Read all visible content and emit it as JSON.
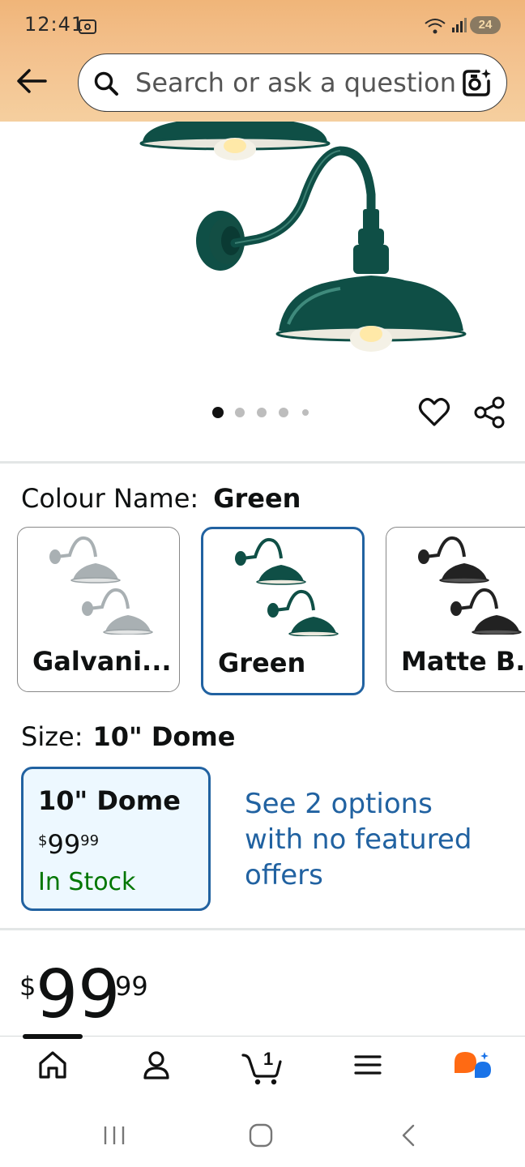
{
  "status_bar": {
    "time": "12:41",
    "battery": "24"
  },
  "search": {
    "placeholder": "Search or ask a question"
  },
  "gallery": {
    "dot_count": 5,
    "active_index": 0
  },
  "colour": {
    "label": "Colour Name:",
    "selected": "Green",
    "options": [
      {
        "name": "Galvani...",
        "swatch": "#a9b0b3"
      },
      {
        "name": "Green",
        "swatch": "#0f4f46"
      },
      {
        "name": "Matte B..",
        "swatch": "#222222"
      }
    ]
  },
  "size": {
    "label": "Size:",
    "selected": "10\" Dome",
    "card": {
      "title": "10\" Dome",
      "price_symbol": "$",
      "price_whole": "99",
      "price_fraction": "99",
      "stock": "In Stock"
    },
    "see_options": "See 2 options with no featured offers"
  },
  "price": {
    "symbol": "$",
    "whole": "99",
    "fraction": "99"
  },
  "bottom_nav": {
    "items": [
      "home-icon",
      "account-icon",
      "cart-icon",
      "menu-icon",
      "rufus-icon"
    ],
    "cart_count": "1"
  },
  "colors": {
    "accent_blue": "#2162a1",
    "in_stock_green": "#007600",
    "header_orange": "#f3c08c"
  }
}
